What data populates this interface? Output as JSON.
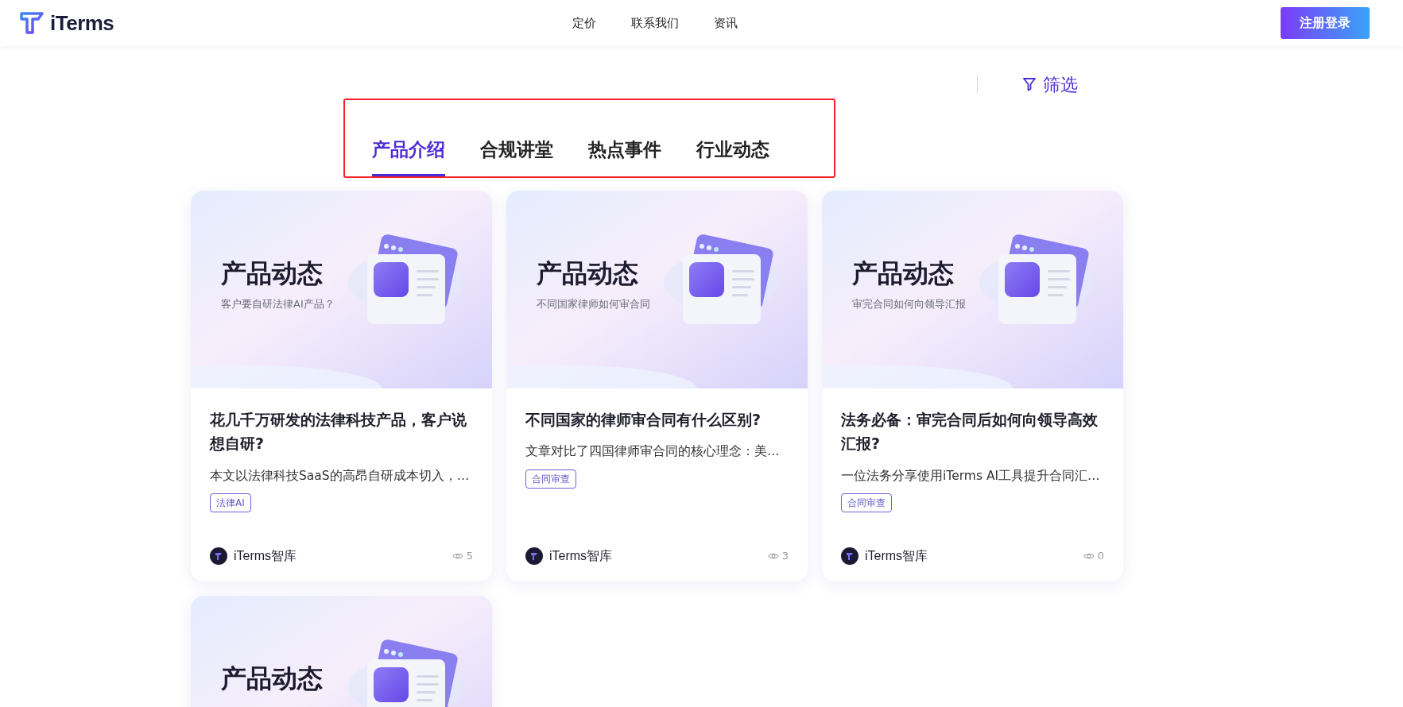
{
  "header": {
    "logo_text": "iTerms",
    "nav": [
      {
        "label": "定价"
      },
      {
        "label": "联系我们"
      },
      {
        "label": "资讯"
      }
    ],
    "signup_button": "注册登录"
  },
  "tabs": [
    {
      "label": "产品介绍",
      "selected": true
    },
    {
      "label": "合规讲堂",
      "selected": false
    },
    {
      "label": "热点事件",
      "selected": false
    },
    {
      "label": "行业动态",
      "selected": false
    }
  ],
  "filter": {
    "label": "筛选"
  },
  "cards": [
    {
      "cover_title": "产品动态",
      "cover_subtitle": "客户要自研法律AI产品？",
      "title": "花几千万研发的法律科技产品，客户说想自研?",
      "summary": "本文以法律科技SaaS的高昂自研成本切入，…",
      "tag": "法律AI",
      "author": "iTerms智库",
      "views": "5"
    },
    {
      "cover_title": "产品动态",
      "cover_subtitle": "不同国家律师如何审合同",
      "title": "不同国家的律师审合同有什么区别?",
      "summary": "文章对比了四国律师审合同的核心理念：美…",
      "tag": "合同审查",
      "author": "iTerms智库",
      "views": "3"
    },
    {
      "cover_title": "产品动态",
      "cover_subtitle": "审完合同如何向领导汇报",
      "title": "法务必备：审完合同后如何向领导高效汇报?",
      "summary": "一位法务分享使用iTerms AI工具提升合同汇…",
      "tag": "合同审查",
      "author": "iTerms智库",
      "views": "0"
    },
    {
      "cover_title": "产品动态"
    }
  ]
}
